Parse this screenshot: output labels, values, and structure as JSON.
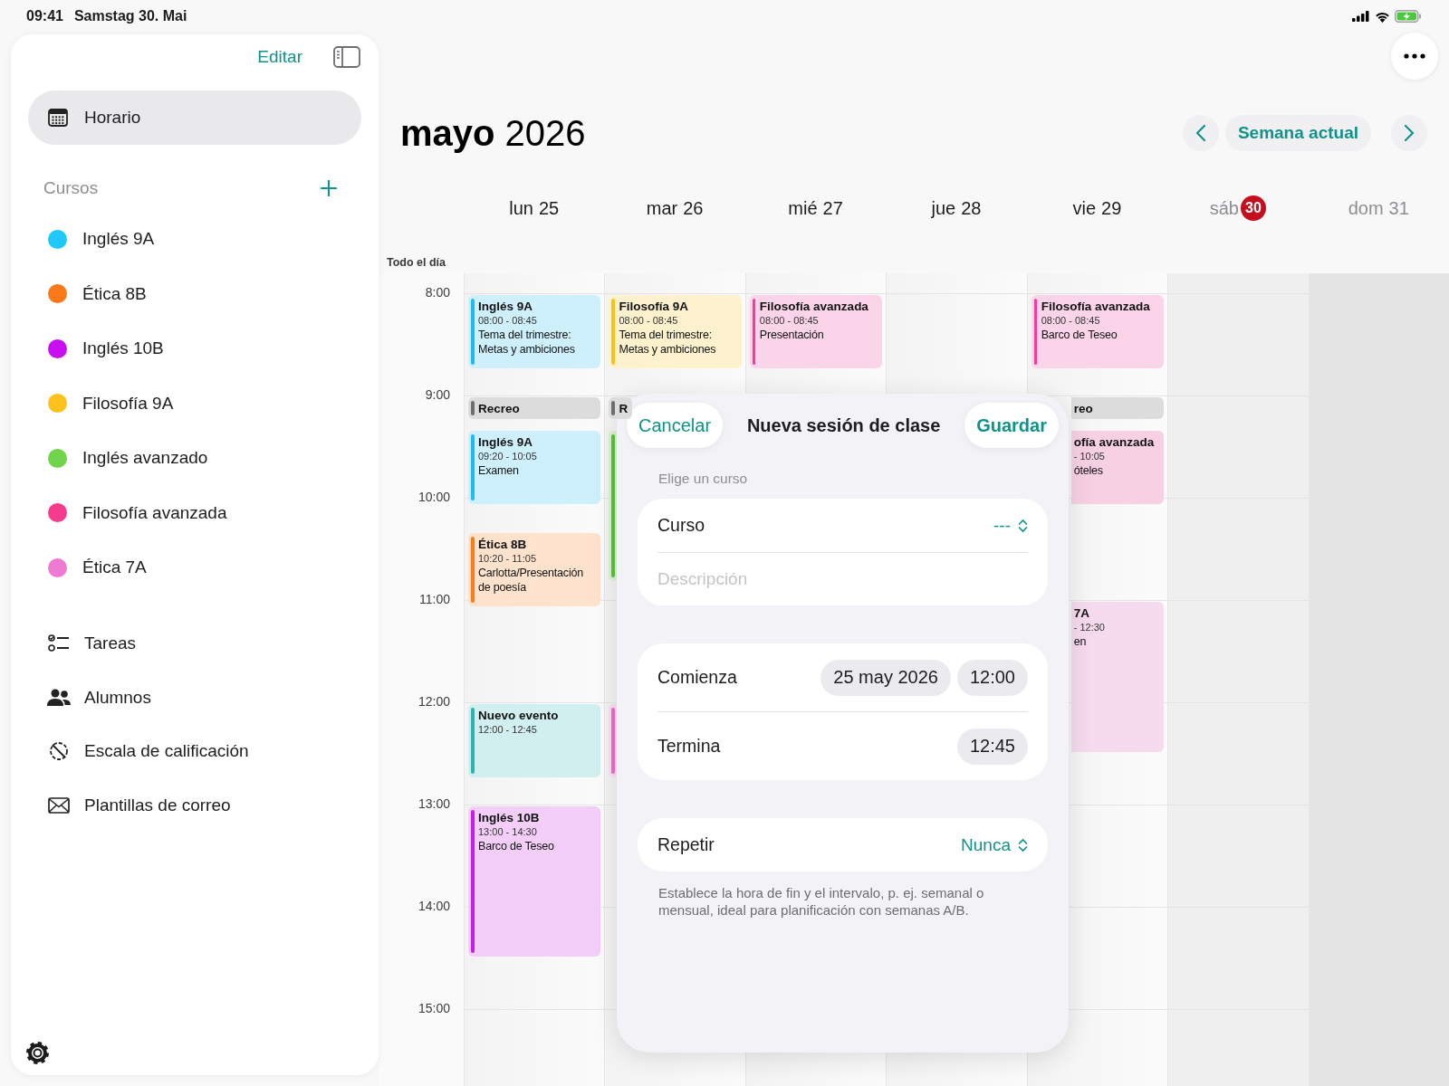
{
  "status_bar": {
    "time": "09:41",
    "date": "Samstag 30. Mai"
  },
  "sidebar": {
    "edit": "Editar",
    "nav": [
      {
        "label": "Horario",
        "selected": true
      }
    ],
    "section": "Cursos",
    "courses": [
      {
        "name": "Inglés 9A",
        "color": "#1ec8fa"
      },
      {
        "name": "Ética 8B",
        "color": "#fa7819"
      },
      {
        "name": "Inglés 10B",
        "color": "#c80ff0"
      },
      {
        "name": "Filosofía 9A",
        "color": "#fcc21b"
      },
      {
        "name": "Inglés avanzado",
        "color": "#6fd44b"
      },
      {
        "name": "Filosofía avanzada",
        "color": "#f53c8c"
      },
      {
        "name": "Ética 7A",
        "color": "#ef7ad3"
      }
    ],
    "items": [
      {
        "label": "Tareas",
        "kind": "tasks"
      },
      {
        "label": "Alumnos",
        "kind": "students"
      },
      {
        "label": "Escala de calificación",
        "kind": "grading"
      },
      {
        "label": "Plantillas de correo",
        "kind": "mail"
      }
    ]
  },
  "header": {
    "title": "**mayo** 2026",
    "today_button": "Semana actual"
  },
  "calendar": {
    "all_day_label": "Todo el día",
    "hours": [
      "8:00",
      "9:00",
      "10:00",
      "11:00",
      "12:00",
      "13:00",
      "14:00",
      "15:00"
    ],
    "days": [
      {
        "weekday": "lun",
        "date": "25",
        "weekend": false,
        "today": false,
        "events": [
          {
            "kind": "lesson",
            "title": "Inglés 9A",
            "time": "08:00 - 08:45",
            "note": "Tema del trimestre: Metas y ambiciones",
            "color": "#1ebcf5"
          },
          {
            "kind": "break",
            "title": "Recreo",
            "color": "#6e6e6e"
          },
          {
            "kind": "lesson",
            "title": "Inglés 9A",
            "time": "09:20 - 10:05",
            "note": "Examen",
            "color": "#1ebcf5"
          },
          {
            "kind": "lesson",
            "title": "Ética 8B",
            "time": "10:20 - 11:05",
            "note": "Carlotta/Presentación de poesía",
            "color": "#f97d16"
          },
          {
            "kind": "lesson",
            "title": "Nuevo evento",
            "time": "12:00 - 12:45",
            "color": "#2bb5b0"
          },
          {
            "kind": "lesson",
            "title": "Inglés 10B",
            "time": "13:00 - 14:30",
            "note": "Barco de Teseo",
            "color": "#c81ee5"
          }
        ]
      },
      {
        "weekday": "mar",
        "date": "26",
        "weekend": false,
        "today": false,
        "events": [
          {
            "kind": "lesson",
            "title": "Filosofía 9A",
            "time": "08:00 - 08:45",
            "note": "Tema del trimestre: Metas y ambiciones",
            "color": "#f8c21a"
          },
          {
            "kind": "break",
            "title": "R",
            "color": "#6e6e6e"
          },
          {
            "kind": "strip",
            "color": "#5cc43a"
          },
          {
            "kind": "strip",
            "color": "#f06cc8"
          }
        ]
      },
      {
        "weekday": "mié",
        "date": "27",
        "weekend": false,
        "today": false,
        "events": [
          {
            "kind": "lesson",
            "title": "Filosofía avanzada",
            "time": "08:00 - 08:45",
            "note": "Presentación",
            "color": "#f23d9b"
          }
        ]
      },
      {
        "weekday": "jue",
        "date": "28",
        "weekend": false,
        "today": false
      },
      {
        "weekday": "vie",
        "date": "29",
        "weekend": false,
        "today": false,
        "events": [
          {
            "kind": "lesson",
            "title": "Filosofía avanzada",
            "time": "08:00 - 08:45",
            "note": "Barco de Teseo",
            "color": "#f23d9b"
          },
          {
            "kind": "break",
            "title": "reo",
            "color": "#dcdcdc"
          },
          {
            "kind": "lesson",
            "title": "ofía avanzada",
            "time": "- 10:05",
            "note": "óteles",
            "color": "#f8d0e4"
          },
          {
            "kind": "lesson",
            "title": "7A",
            "time": "- 12:30",
            "note": "en",
            "color": "#f6daee"
          }
        ]
      },
      {
        "weekday": "sáb",
        "date": "30",
        "weekend": true,
        "today": true
      },
      {
        "weekday": "dom",
        "date": "31",
        "weekend": true,
        "today": false
      }
    ]
  },
  "dialog": {
    "cancel": "Cancelar",
    "title": "Nueva sesión de clase",
    "save": "Guardar",
    "course_hint": "Elige un curso",
    "course": {
      "label": "Curso",
      "value": "---"
    },
    "description": {
      "placeholder": "Descripción"
    },
    "start": {
      "label": "Comienza",
      "date": "25 may 2026",
      "time": "12:00"
    },
    "end": {
      "label": "Termina",
      "time": "12:45"
    },
    "repeat": {
      "label": "Repetir",
      "value": "Nunca"
    },
    "footnote": "Establece la hora de fin y el intervalo, p. ej. semanal o mensual, ideal para planificación con semanas A/B."
  }
}
